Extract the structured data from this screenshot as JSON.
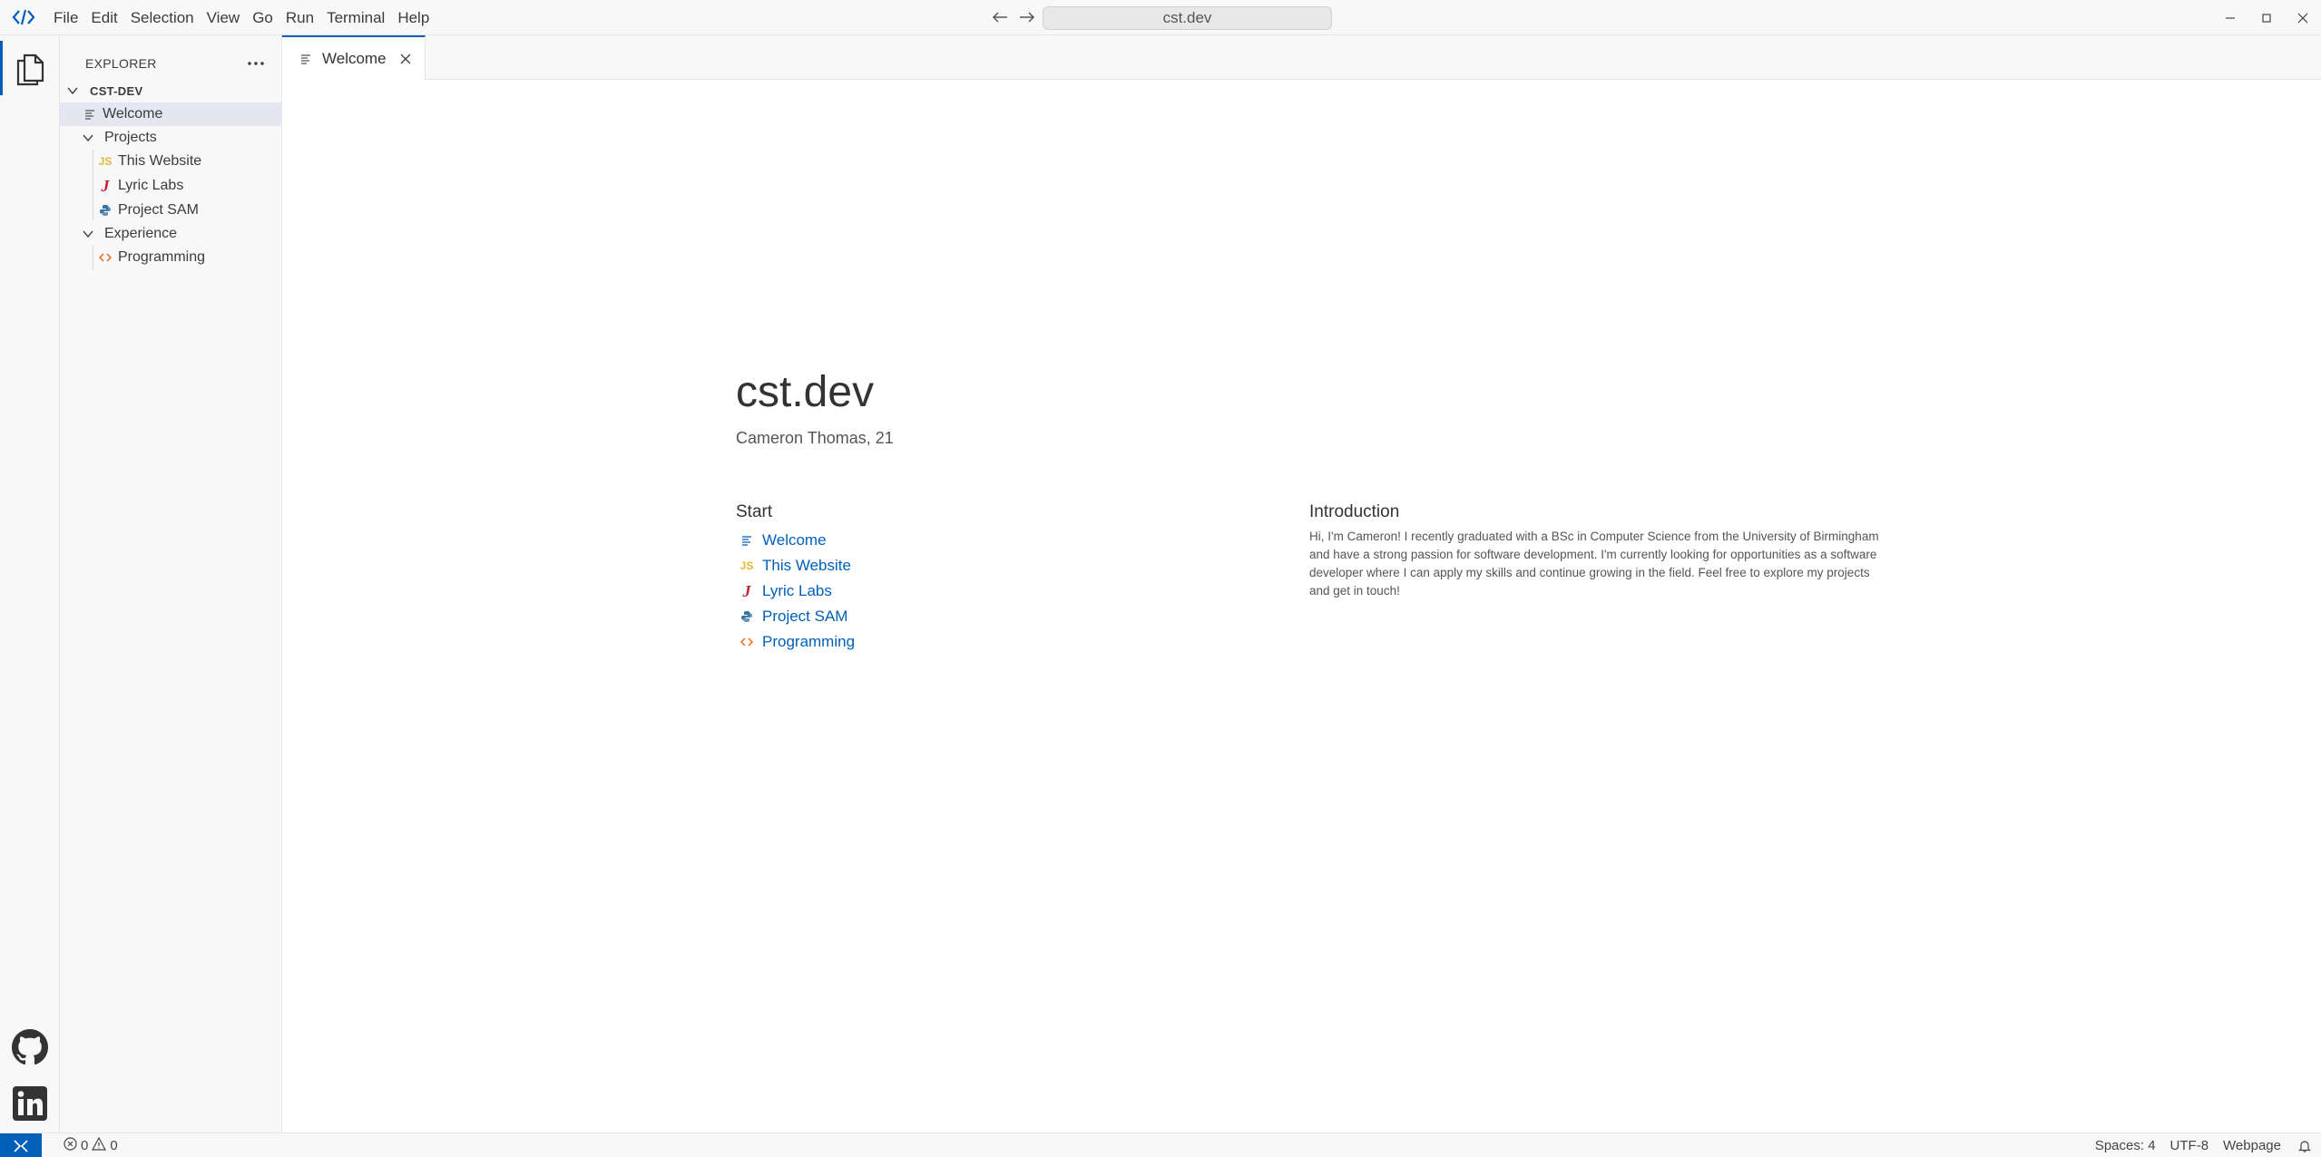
{
  "titlebar": {
    "menu": [
      "File",
      "Edit",
      "Selection",
      "View",
      "Go",
      "Run",
      "Terminal",
      "Help"
    ],
    "address": "cst.dev"
  },
  "sidebar": {
    "title": "EXPLORER",
    "root": "CST-DEV",
    "items": [
      {
        "label": "Welcome",
        "icon": "document-icon",
        "depth": 1,
        "active": true
      },
      {
        "label": "Projects",
        "icon": "folder-open-chevron",
        "depth": 1
      },
      {
        "label": "This Website",
        "icon": "javascript-icon",
        "depth": 2
      },
      {
        "label": "Lyric Labs",
        "icon": "java-icon",
        "depth": 2
      },
      {
        "label": "Project SAM",
        "icon": "python-icon",
        "depth": 2
      },
      {
        "label": "Experience",
        "icon": "folder-open-chevron",
        "depth": 1
      },
      {
        "label": "Programming",
        "icon": "code-icon",
        "depth": 2
      }
    ]
  },
  "tab": {
    "label": "Welcome"
  },
  "welcome": {
    "title": "cst.dev",
    "subtitle": "Cameron Thomas, 21",
    "start_title": "Start",
    "start_links": [
      "Welcome",
      "This Website",
      "Lyric Labs",
      "Project SAM",
      "Programming"
    ],
    "intro_title": "Introduction",
    "intro_text": "Hi, I'm Cameron! I recently graduated with a BSc in Computer Science from the University of Birmingham and have a strong passion for software development. I'm currently looking for opportunities as a software developer where I can apply my skills and continue growing in the field. Feel free to explore my projects and get in touch!"
  },
  "statusbar": {
    "errors": "0",
    "warnings": "0",
    "spaces": "Spaces: 4",
    "encoding": "UTF-8",
    "language": "Webpage"
  },
  "colors": {
    "accent": "#005fb8",
    "javascript": "#e3b93a",
    "java": "#c4223a",
    "python": "#3572a5",
    "code": "#e37933"
  }
}
